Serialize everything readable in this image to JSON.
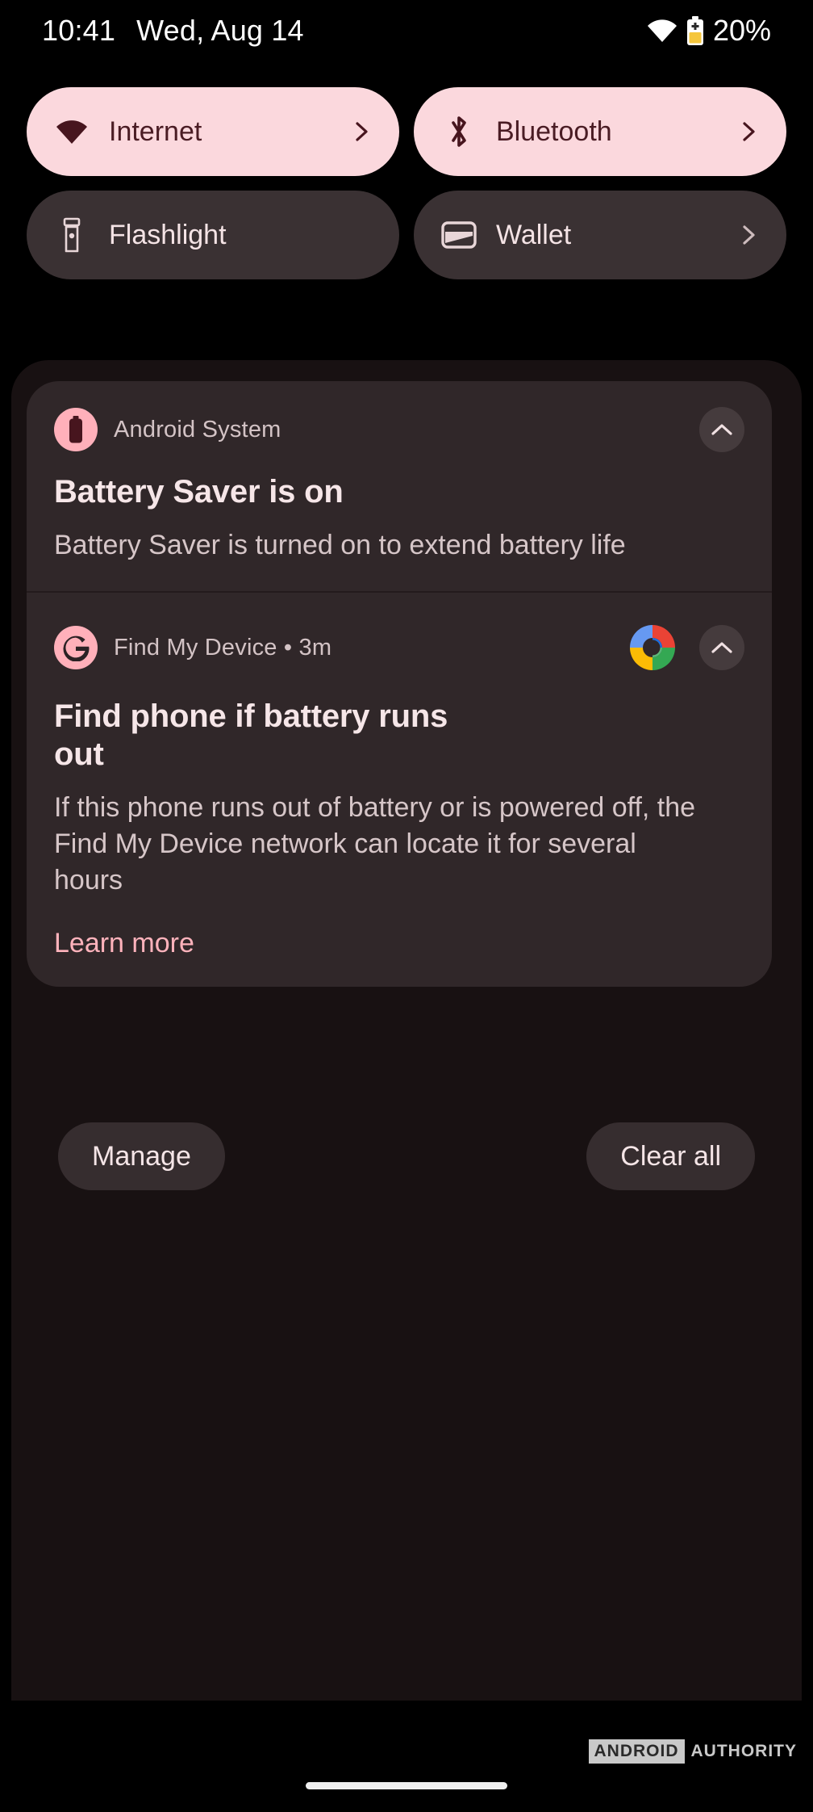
{
  "status_bar": {
    "time": "10:41",
    "date": "Wed, Aug 14",
    "battery_percent": "20%",
    "wifi_icon": "wifi-icon",
    "battery_saver_icon": "battery-saver-icon"
  },
  "quick_settings": {
    "tiles": [
      {
        "label": "Internet",
        "icon": "wifi-icon",
        "state": "active",
        "has_chevron": true
      },
      {
        "label": "Bluetooth",
        "icon": "bluetooth-icon",
        "state": "active",
        "has_chevron": true
      },
      {
        "label": "Flashlight",
        "icon": "flashlight-icon",
        "state": "inactive",
        "has_chevron": false
      },
      {
        "label": "Wallet",
        "icon": "wallet-icon",
        "state": "inactive",
        "has_chevron": true
      }
    ]
  },
  "notifications": [
    {
      "app_name": "Android System",
      "avatar_icon": "battery-icon",
      "title": "Battery Saver is on",
      "body": "Battery Saver is turned on to extend battery life",
      "expand_icon": "chevron-up-icon",
      "has_large_icon": false,
      "link": null
    },
    {
      "app_name": "Find My Device • 3m",
      "avatar_icon": "google-g-icon",
      "title": "Find phone if battery runs out",
      "body": "If this phone runs out of battery or is powered off, the Find My Device network can locate it for several hours",
      "expand_icon": "chevron-up-icon",
      "has_large_icon": true,
      "large_icon": "find-my-device-logo",
      "link": "Learn more"
    }
  ],
  "footer": {
    "manage_label": "Manage",
    "clear_all_label": "Clear all"
  },
  "watermark": {
    "brand": "ANDROID",
    "suffix": "AUTHORITY"
  },
  "colors": {
    "accent_pink": "#FBD8DD",
    "accent_pink_text": "#4A1C24",
    "link_pink": "#FFB3BC",
    "tile_inactive": "#3A3133",
    "notif_bg": "#302729",
    "shade_bg": "#181112",
    "screen_bg": "#000000"
  }
}
